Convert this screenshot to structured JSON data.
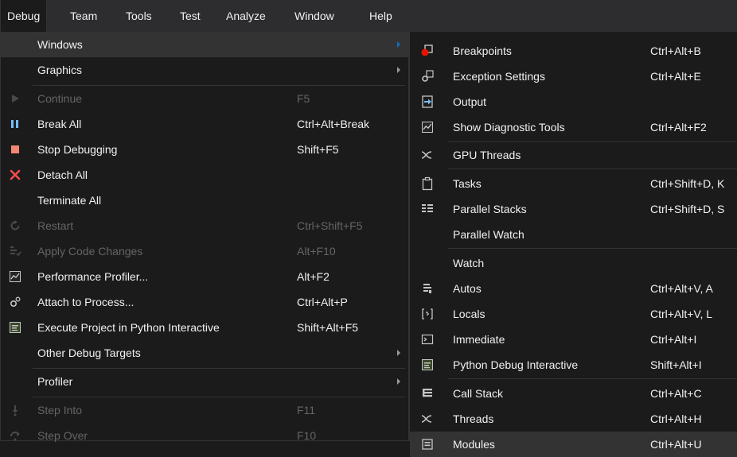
{
  "menubar": {
    "items": [
      {
        "label": "Debug"
      },
      {
        "label": "Team"
      },
      {
        "label": "Tools"
      },
      {
        "label": "Test"
      },
      {
        "label": "Analyze"
      },
      {
        "label": "Window"
      },
      {
        "label": "Help"
      }
    ]
  },
  "debug_menu": {
    "items": [
      {
        "label": "Windows",
        "shortcut": ""
      },
      {
        "label": "Graphics",
        "shortcut": ""
      },
      {
        "label": "Continue",
        "shortcut": "F5"
      },
      {
        "label": "Break All",
        "shortcut": "Ctrl+Alt+Break"
      },
      {
        "label": "Stop Debugging",
        "shortcut": "Shift+F5"
      },
      {
        "label": "Detach All",
        "shortcut": ""
      },
      {
        "label": "Terminate All",
        "shortcut": ""
      },
      {
        "label": "Restart",
        "shortcut": "Ctrl+Shift+F5"
      },
      {
        "label": "Apply Code Changes",
        "shortcut": "Alt+F10"
      },
      {
        "label": "Performance Profiler...",
        "shortcut": "Alt+F2"
      },
      {
        "label": "Attach to Process...",
        "shortcut": "Ctrl+Alt+P"
      },
      {
        "label": "Execute Project in Python Interactive",
        "shortcut": "Shift+Alt+F5"
      },
      {
        "label": "Other Debug Targets",
        "shortcut": ""
      },
      {
        "label": "Profiler",
        "shortcut": ""
      },
      {
        "label": "Step Into",
        "shortcut": "F11"
      },
      {
        "label": "Step Over",
        "shortcut": "F10"
      }
    ]
  },
  "windows_menu": {
    "items": [
      {
        "label": "Breakpoints",
        "shortcut": "Ctrl+Alt+B"
      },
      {
        "label": "Exception Settings",
        "shortcut": "Ctrl+Alt+E"
      },
      {
        "label": "Output",
        "shortcut": ""
      },
      {
        "label": "Show Diagnostic Tools",
        "shortcut": "Ctrl+Alt+F2"
      },
      {
        "label": "GPU Threads",
        "shortcut": ""
      },
      {
        "label": "Tasks",
        "shortcut": "Ctrl+Shift+D, K"
      },
      {
        "label": "Parallel Stacks",
        "shortcut": "Ctrl+Shift+D, S"
      },
      {
        "label": "Parallel Watch",
        "shortcut": ""
      },
      {
        "label": "Watch",
        "shortcut": ""
      },
      {
        "label": "Autos",
        "shortcut": "Ctrl+Alt+V, A"
      },
      {
        "label": "Locals",
        "shortcut": "Ctrl+Alt+V, L"
      },
      {
        "label": "Immediate",
        "shortcut": "Ctrl+Alt+I"
      },
      {
        "label": "Python Debug Interactive",
        "shortcut": "Shift+Alt+I"
      },
      {
        "label": "Call Stack",
        "shortcut": "Ctrl+Alt+C"
      },
      {
        "label": "Threads",
        "shortcut": "Ctrl+Alt+H"
      },
      {
        "label": "Modules",
        "shortcut": "Ctrl+Alt+U"
      }
    ]
  },
  "colors": {
    "background": "#1b1b1c",
    "menubar": "#2d2d30",
    "highlight": "#333334",
    "text": "#f1f1f1",
    "disabled_text": "#656565",
    "accent_blue": "#0e70c0",
    "breakpoint_red": "#e51400",
    "stop_red": "#f48771"
  }
}
